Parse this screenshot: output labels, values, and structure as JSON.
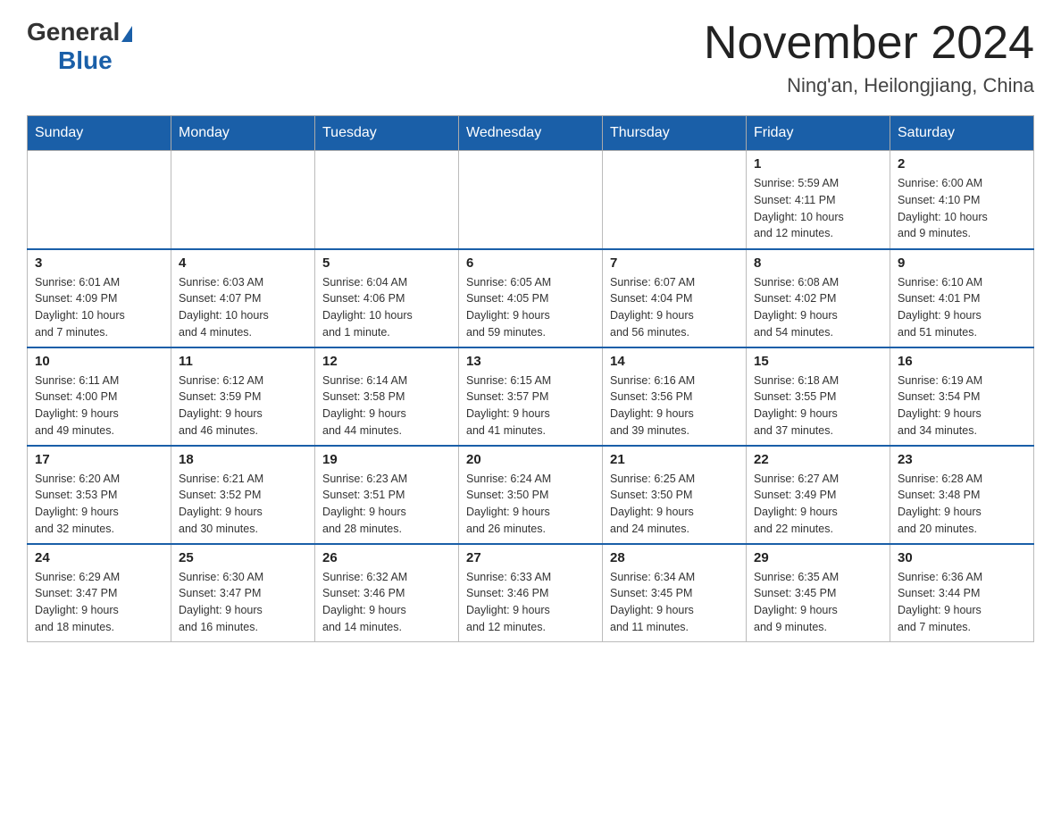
{
  "header": {
    "logo_general": "General",
    "logo_blue": "Blue",
    "month_title": "November 2024",
    "location": "Ning'an, Heilongjiang, China"
  },
  "days_of_week": [
    "Sunday",
    "Monday",
    "Tuesday",
    "Wednesday",
    "Thursday",
    "Friday",
    "Saturday"
  ],
  "weeks": [
    [
      {
        "day": "",
        "info": ""
      },
      {
        "day": "",
        "info": ""
      },
      {
        "day": "",
        "info": ""
      },
      {
        "day": "",
        "info": ""
      },
      {
        "day": "",
        "info": ""
      },
      {
        "day": "1",
        "info": "Sunrise: 5:59 AM\nSunset: 4:11 PM\nDaylight: 10 hours\nand 12 minutes."
      },
      {
        "day": "2",
        "info": "Sunrise: 6:00 AM\nSunset: 4:10 PM\nDaylight: 10 hours\nand 9 minutes."
      }
    ],
    [
      {
        "day": "3",
        "info": "Sunrise: 6:01 AM\nSunset: 4:09 PM\nDaylight: 10 hours\nand 7 minutes."
      },
      {
        "day": "4",
        "info": "Sunrise: 6:03 AM\nSunset: 4:07 PM\nDaylight: 10 hours\nand 4 minutes."
      },
      {
        "day": "5",
        "info": "Sunrise: 6:04 AM\nSunset: 4:06 PM\nDaylight: 10 hours\nand 1 minute."
      },
      {
        "day": "6",
        "info": "Sunrise: 6:05 AM\nSunset: 4:05 PM\nDaylight: 9 hours\nand 59 minutes."
      },
      {
        "day": "7",
        "info": "Sunrise: 6:07 AM\nSunset: 4:04 PM\nDaylight: 9 hours\nand 56 minutes."
      },
      {
        "day": "8",
        "info": "Sunrise: 6:08 AM\nSunset: 4:02 PM\nDaylight: 9 hours\nand 54 minutes."
      },
      {
        "day": "9",
        "info": "Sunrise: 6:10 AM\nSunset: 4:01 PM\nDaylight: 9 hours\nand 51 minutes."
      }
    ],
    [
      {
        "day": "10",
        "info": "Sunrise: 6:11 AM\nSunset: 4:00 PM\nDaylight: 9 hours\nand 49 minutes."
      },
      {
        "day": "11",
        "info": "Sunrise: 6:12 AM\nSunset: 3:59 PM\nDaylight: 9 hours\nand 46 minutes."
      },
      {
        "day": "12",
        "info": "Sunrise: 6:14 AM\nSunset: 3:58 PM\nDaylight: 9 hours\nand 44 minutes."
      },
      {
        "day": "13",
        "info": "Sunrise: 6:15 AM\nSunset: 3:57 PM\nDaylight: 9 hours\nand 41 minutes."
      },
      {
        "day": "14",
        "info": "Sunrise: 6:16 AM\nSunset: 3:56 PM\nDaylight: 9 hours\nand 39 minutes."
      },
      {
        "day": "15",
        "info": "Sunrise: 6:18 AM\nSunset: 3:55 PM\nDaylight: 9 hours\nand 37 minutes."
      },
      {
        "day": "16",
        "info": "Sunrise: 6:19 AM\nSunset: 3:54 PM\nDaylight: 9 hours\nand 34 minutes."
      }
    ],
    [
      {
        "day": "17",
        "info": "Sunrise: 6:20 AM\nSunset: 3:53 PM\nDaylight: 9 hours\nand 32 minutes."
      },
      {
        "day": "18",
        "info": "Sunrise: 6:21 AM\nSunset: 3:52 PM\nDaylight: 9 hours\nand 30 minutes."
      },
      {
        "day": "19",
        "info": "Sunrise: 6:23 AM\nSunset: 3:51 PM\nDaylight: 9 hours\nand 28 minutes."
      },
      {
        "day": "20",
        "info": "Sunrise: 6:24 AM\nSunset: 3:50 PM\nDaylight: 9 hours\nand 26 minutes."
      },
      {
        "day": "21",
        "info": "Sunrise: 6:25 AM\nSunset: 3:50 PM\nDaylight: 9 hours\nand 24 minutes."
      },
      {
        "day": "22",
        "info": "Sunrise: 6:27 AM\nSunset: 3:49 PM\nDaylight: 9 hours\nand 22 minutes."
      },
      {
        "day": "23",
        "info": "Sunrise: 6:28 AM\nSunset: 3:48 PM\nDaylight: 9 hours\nand 20 minutes."
      }
    ],
    [
      {
        "day": "24",
        "info": "Sunrise: 6:29 AM\nSunset: 3:47 PM\nDaylight: 9 hours\nand 18 minutes."
      },
      {
        "day": "25",
        "info": "Sunrise: 6:30 AM\nSunset: 3:47 PM\nDaylight: 9 hours\nand 16 minutes."
      },
      {
        "day": "26",
        "info": "Sunrise: 6:32 AM\nSunset: 3:46 PM\nDaylight: 9 hours\nand 14 minutes."
      },
      {
        "day": "27",
        "info": "Sunrise: 6:33 AM\nSunset: 3:46 PM\nDaylight: 9 hours\nand 12 minutes."
      },
      {
        "day": "28",
        "info": "Sunrise: 6:34 AM\nSunset: 3:45 PM\nDaylight: 9 hours\nand 11 minutes."
      },
      {
        "day": "29",
        "info": "Sunrise: 6:35 AM\nSunset: 3:45 PM\nDaylight: 9 hours\nand 9 minutes."
      },
      {
        "day": "30",
        "info": "Sunrise: 6:36 AM\nSunset: 3:44 PM\nDaylight: 9 hours\nand 7 minutes."
      }
    ]
  ]
}
